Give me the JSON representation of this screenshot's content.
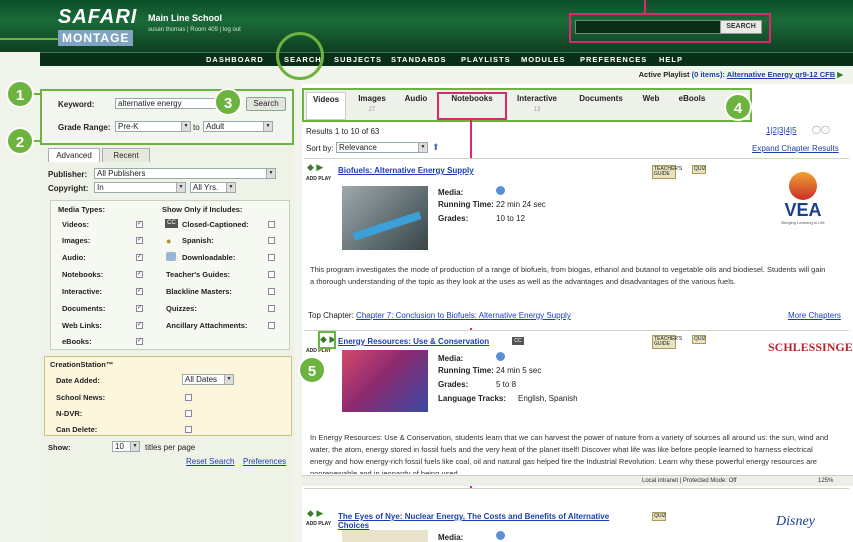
{
  "header": {
    "logo_line1": "SAFARI",
    "logo_line2": "MONTAGE",
    "school": "Main Line School",
    "user_line": "susan thomas | Room 409 | log out",
    "search_button": "SEARCH"
  },
  "nav": [
    "DASHBOARD",
    "SEARCH",
    "SUBJECTS",
    "STANDARDS",
    "PLAYLISTS",
    "MODULES",
    "PREFERENCES",
    "HELP"
  ],
  "playlist": {
    "label": "Active Playlist",
    "count": "(0 items):",
    "name": "Alternative Energy gr9-12 CFB"
  },
  "search": {
    "keyword_label": "Keyword:",
    "keyword_value": "alternative energy",
    "search_button": "Search",
    "grade_label": "Grade Range:",
    "grade_from": "Pre-K",
    "grade_to_label": "to",
    "grade_to": "Adult"
  },
  "left_tabs": [
    "Advanced",
    "Recent"
  ],
  "filters": {
    "publisher_label": "Publisher:",
    "publisher_value": "All Publishers",
    "copyright_label": "Copyright:",
    "copyright_value": "In",
    "years_value": "All Yrs.",
    "media_types_title": "Media Types:",
    "media_types": [
      "Videos:",
      "Images:",
      "Audio:",
      "Notebooks:",
      "Interactive:",
      "Documents:",
      "Web Links:",
      "eBooks:"
    ],
    "show_only_title": "Show Only if Includes:",
    "show_only": [
      "Closed-Captioned:",
      "Spanish:",
      "Downloadable:",
      "Teacher's Guides:",
      "Blackline Masters:",
      "Quizzes:",
      "Ancillary Attachments:"
    ],
    "cc_icon_text": "CC"
  },
  "creation": {
    "title": "CreationStation™",
    "items": [
      "Date Added:",
      "School News:",
      "N-DVR:",
      "Can Delete:"
    ],
    "dates_value": "All Dates"
  },
  "show": {
    "label": "Show:",
    "value": "10",
    "suffix": "titles per page",
    "reset": "Reset Search",
    "prefs": "Preferences"
  },
  "media_tabs": [
    {
      "label": "Videos",
      "count": ""
    },
    {
      "label": "Images",
      "count": "27"
    },
    {
      "label": "Audio",
      "count": ""
    },
    {
      "label": "Notebooks",
      "count": ""
    },
    {
      "label": "Interactive",
      "count": "13"
    },
    {
      "label": "Documents",
      "count": ""
    },
    {
      "label": "Web",
      "count": ""
    },
    {
      "label": "eBools",
      "count": ""
    }
  ],
  "results": {
    "summary": "Results 1 to 10 of 63",
    "pages": "1|2|3|4|5",
    "sort_label": "Sort by:",
    "sort_value": "Relevance",
    "expand": "Expand Chapter Results"
  },
  "cards": [
    {
      "title": "Biofuels: Alternative Energy Supply",
      "media_label": "Media:",
      "time_label": "Running Time:",
      "time": "22 min 24 sec",
      "grades_label": "Grades:",
      "grades": "10 to 12",
      "desc": "This program investigates the mode of production of a range of biofuels, from biogas, ethanol and butanol to vegetable oils and biodiesel. Students will gain a thorough understanding of the topic as they look at the uses as well as the advantages and disadvantages of the various fuels.",
      "chapter_label": "Top Chapter:",
      "chapter_link": "Chapter 7: Conclusion to Biofuels: Alternative Energy Supply",
      "more": "More Chapters",
      "logo": "VEA",
      "logo_tag": "Bringing Learning to Life",
      "badge1": "TEACHER'S GUIDE",
      "badge2": "QUIZ"
    },
    {
      "title": "Energy Resources: Use & Conservation",
      "media_label": "Media:",
      "time_label": "Running Time:",
      "time": "24 min 5 sec",
      "grades_label": "Grades:",
      "grades": "5 to 8",
      "lang_label": "Language Tracks:",
      "lang": "English, Spanish",
      "desc": "In Energy Resources: Use & Conservation, students learn that we can harvest the power of nature from a variety of sources all around us: the sun, wind and water, the atom, energy stored in fossil fuels and the very heat of the planet itself! Discover what life was like before people learned to harness electrical energy and how energy-rich fossil fuels like coal, oil and natural gas helped fire the Industrial Revolution. Learn why these powerful energy resources are nonrenewable and in jeopardy of being used...",
      "logo": "SCHLESSINGER",
      "badge1": "TEACHER'S GUIDE",
      "badge2": "QUIZ"
    },
    {
      "title": "The Eyes of Nye: Nuclear Energy, The Costs and Benefits of Alternative Choices",
      "media_label": "Media:",
      "logo": "Disney",
      "badge2": "QUIZ"
    }
  ],
  "addplay": "ADD PLAY",
  "statusbar": {
    "zone": "Local intranet | Protected Mode: Off",
    "zoom": "125%"
  },
  "callouts": [
    "1",
    "2",
    "3",
    "4",
    "5"
  ]
}
